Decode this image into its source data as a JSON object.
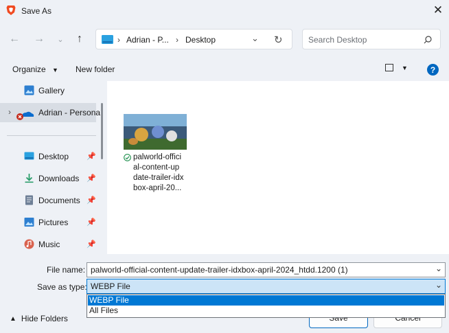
{
  "window": {
    "title": "Save As"
  },
  "address": {
    "crumbs": [
      "Adrian - P...",
      "Desktop"
    ]
  },
  "search": {
    "placeholder": "Search Desktop"
  },
  "toolbar": {
    "organize": "Organize",
    "new_folder": "New folder"
  },
  "nav": {
    "gallery": "Gallery",
    "onedrive": "Adrian - Persona",
    "pinned": [
      {
        "label": "Desktop",
        "icon": "desktop-icon"
      },
      {
        "label": "Downloads",
        "icon": "downloads-icon"
      },
      {
        "label": "Documents",
        "icon": "documents-icon"
      },
      {
        "label": "Pictures",
        "icon": "pictures-icon"
      },
      {
        "label": "Music",
        "icon": "music-icon"
      }
    ]
  },
  "file": {
    "name_lines": [
      "palworld-offici",
      "al-content-up",
      "date-trailer-idx",
      "box-april-20..."
    ]
  },
  "form": {
    "file_name_label": "File name:",
    "file_name_value": "palworld-official-content-update-trailer-idxbox-april-2024_htdd.1200 (1)",
    "save_type_label": "Save as type:",
    "save_type_value": "WEBP File",
    "save_type_options": [
      "WEBP File",
      "All Files"
    ]
  },
  "footer": {
    "hide_folders": "Hide Folders",
    "save": "Save",
    "cancel": "Cancel"
  },
  "colors": {
    "accent": "#0067c0",
    "selected": "#0078d4",
    "window_bg": "#eef1f6"
  }
}
